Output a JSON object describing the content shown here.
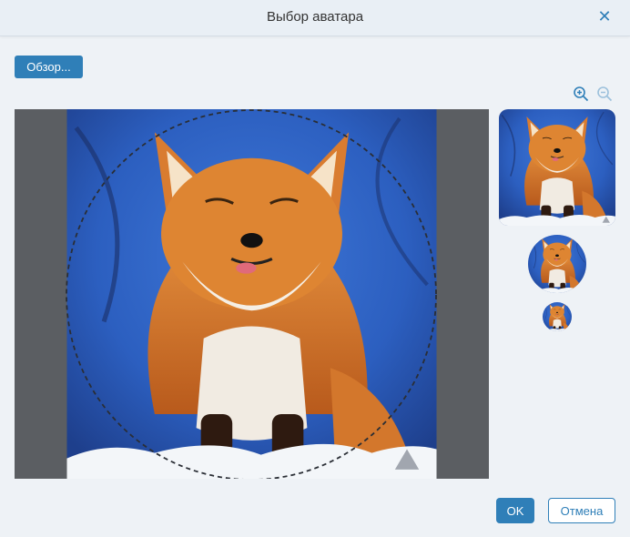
{
  "dialog": {
    "title": "Выбор аватара",
    "close_icon": "close-icon"
  },
  "toolbar": {
    "browse_label": "Обзор...",
    "zoom_in_icon": "zoom-in-icon",
    "zoom_out_icon": "zoom-out-icon"
  },
  "footer": {
    "ok_label": "OK",
    "cancel_label": "Отмена"
  },
  "colors": {
    "accent": "#2f7fb8",
    "crop_background": "#5b5e62",
    "dialog_background": "#eef2f6"
  }
}
